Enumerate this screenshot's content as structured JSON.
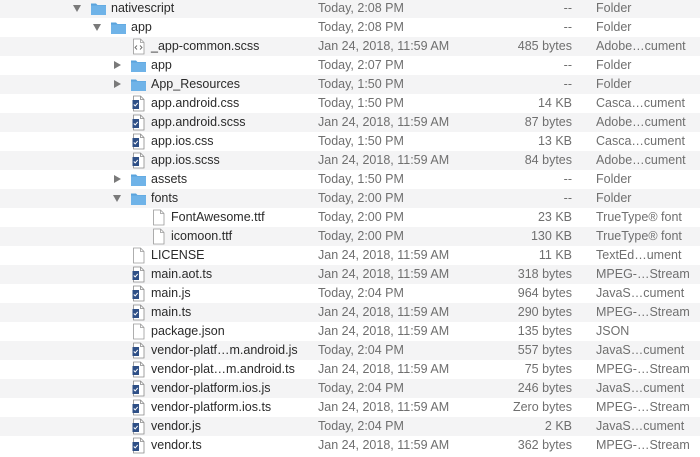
{
  "rows": [
    {
      "name": "nativescript",
      "date": "Today, 2:08 PM",
      "size": "--",
      "kind": "Folder",
      "level": 0,
      "type": "folder",
      "disclosure": "open"
    },
    {
      "name": "app",
      "date": "Today, 2:08 PM",
      "size": "--",
      "kind": "Folder",
      "level": 1,
      "type": "folder",
      "disclosure": "open"
    },
    {
      "name": "_app-common.scss",
      "date": "Jan 24, 2018, 11:59 AM",
      "size": "485 bytes",
      "kind": "Adobe…cument",
      "level": 2,
      "type": "code",
      "disclosure": "none"
    },
    {
      "name": "app",
      "date": "Today, 2:07 PM",
      "size": "--",
      "kind": "Folder",
      "level": 2,
      "type": "folder",
      "disclosure": "closed"
    },
    {
      "name": "App_Resources",
      "date": "Today, 1:50 PM",
      "size": "--",
      "kind": "Folder",
      "level": 2,
      "type": "folder",
      "disclosure": "closed"
    },
    {
      "name": "app.android.css",
      "date": "Today, 1:50 PM",
      "size": "14 KB",
      "kind": "Casca…cument",
      "level": 2,
      "type": "script",
      "disclosure": "none"
    },
    {
      "name": "app.android.scss",
      "date": "Jan 24, 2018, 11:59 AM",
      "size": "87 bytes",
      "kind": "Adobe…cument",
      "level": 2,
      "type": "script",
      "disclosure": "none"
    },
    {
      "name": "app.ios.css",
      "date": "Today, 1:50 PM",
      "size": "13 KB",
      "kind": "Casca…cument",
      "level": 2,
      "type": "script",
      "disclosure": "none"
    },
    {
      "name": "app.ios.scss",
      "date": "Jan 24, 2018, 11:59 AM",
      "size": "84 bytes",
      "kind": "Adobe…cument",
      "level": 2,
      "type": "script",
      "disclosure": "none"
    },
    {
      "name": "assets",
      "date": "Today, 1:50 PM",
      "size": "--",
      "kind": "Folder",
      "level": 2,
      "type": "folder",
      "disclosure": "closed"
    },
    {
      "name": "fonts",
      "date": "Today, 2:00 PM",
      "size": "--",
      "kind": "Folder",
      "level": 2,
      "type": "folder",
      "disclosure": "open"
    },
    {
      "name": "FontAwesome.ttf",
      "date": "Today, 2:00 PM",
      "size": "23 KB",
      "kind": "TrueType® font",
      "level": 3,
      "type": "doc",
      "disclosure": "none"
    },
    {
      "name": "icomoon.ttf",
      "date": "Today, 2:00 PM",
      "size": "130 KB",
      "kind": "TrueType® font",
      "level": 3,
      "type": "doc",
      "disclosure": "none"
    },
    {
      "name": "LICENSE",
      "date": "Jan 24, 2018, 11:59 AM",
      "size": "11 KB",
      "kind": "TextEd…ument",
      "level": 2,
      "type": "doc",
      "disclosure": "none"
    },
    {
      "name": "main.aot.ts",
      "date": "Jan 24, 2018, 11:59 AM",
      "size": "318 bytes",
      "kind": "MPEG-…Stream",
      "level": 2,
      "type": "script",
      "disclosure": "none"
    },
    {
      "name": "main.js",
      "date": "Today, 2:04 PM",
      "size": "964 bytes",
      "kind": "JavaS…cument",
      "level": 2,
      "type": "script",
      "disclosure": "none"
    },
    {
      "name": "main.ts",
      "date": "Jan 24, 2018, 11:59 AM",
      "size": "290 bytes",
      "kind": "MPEG-…Stream",
      "level": 2,
      "type": "script",
      "disclosure": "none"
    },
    {
      "name": "package.json",
      "date": "Jan 24, 2018, 11:59 AM",
      "size": "135 bytes",
      "kind": "JSON",
      "level": 2,
      "type": "doc",
      "disclosure": "none"
    },
    {
      "name": "vendor-platf…m.android.js",
      "date": "Today, 2:04 PM",
      "size": "557 bytes",
      "kind": "JavaS…cument",
      "level": 2,
      "type": "script",
      "disclosure": "none"
    },
    {
      "name": "vendor-plat…m.android.ts",
      "date": "Jan 24, 2018, 11:59 AM",
      "size": "75 bytes",
      "kind": "MPEG-…Stream",
      "level": 2,
      "type": "script",
      "disclosure": "none"
    },
    {
      "name": "vendor-platform.ios.js",
      "date": "Today, 2:04 PM",
      "size": "246 bytes",
      "kind": "JavaS…cument",
      "level": 2,
      "type": "script",
      "disclosure": "none"
    },
    {
      "name": "vendor-platform.ios.ts",
      "date": "Jan 24, 2018, 11:59 AM",
      "size": "Zero bytes",
      "kind": "MPEG-…Stream",
      "level": 2,
      "type": "script",
      "disclosure": "none"
    },
    {
      "name": "vendor.js",
      "date": "Today, 2:04 PM",
      "size": "2 KB",
      "kind": "JavaS…cument",
      "level": 2,
      "type": "script",
      "disclosure": "none"
    },
    {
      "name": "vendor.ts",
      "date": "Jan 24, 2018, 11:59 AM",
      "size": "362 bytes",
      "kind": "MPEG-…Stream",
      "level": 2,
      "type": "script",
      "disclosure": "none"
    }
  ],
  "colors": {
    "folder": "#6fb3e8",
    "folder_tab": "#5aa3dc",
    "row_alt": "#f4f4f5",
    "secondary_text": "#6f6f6f"
  }
}
